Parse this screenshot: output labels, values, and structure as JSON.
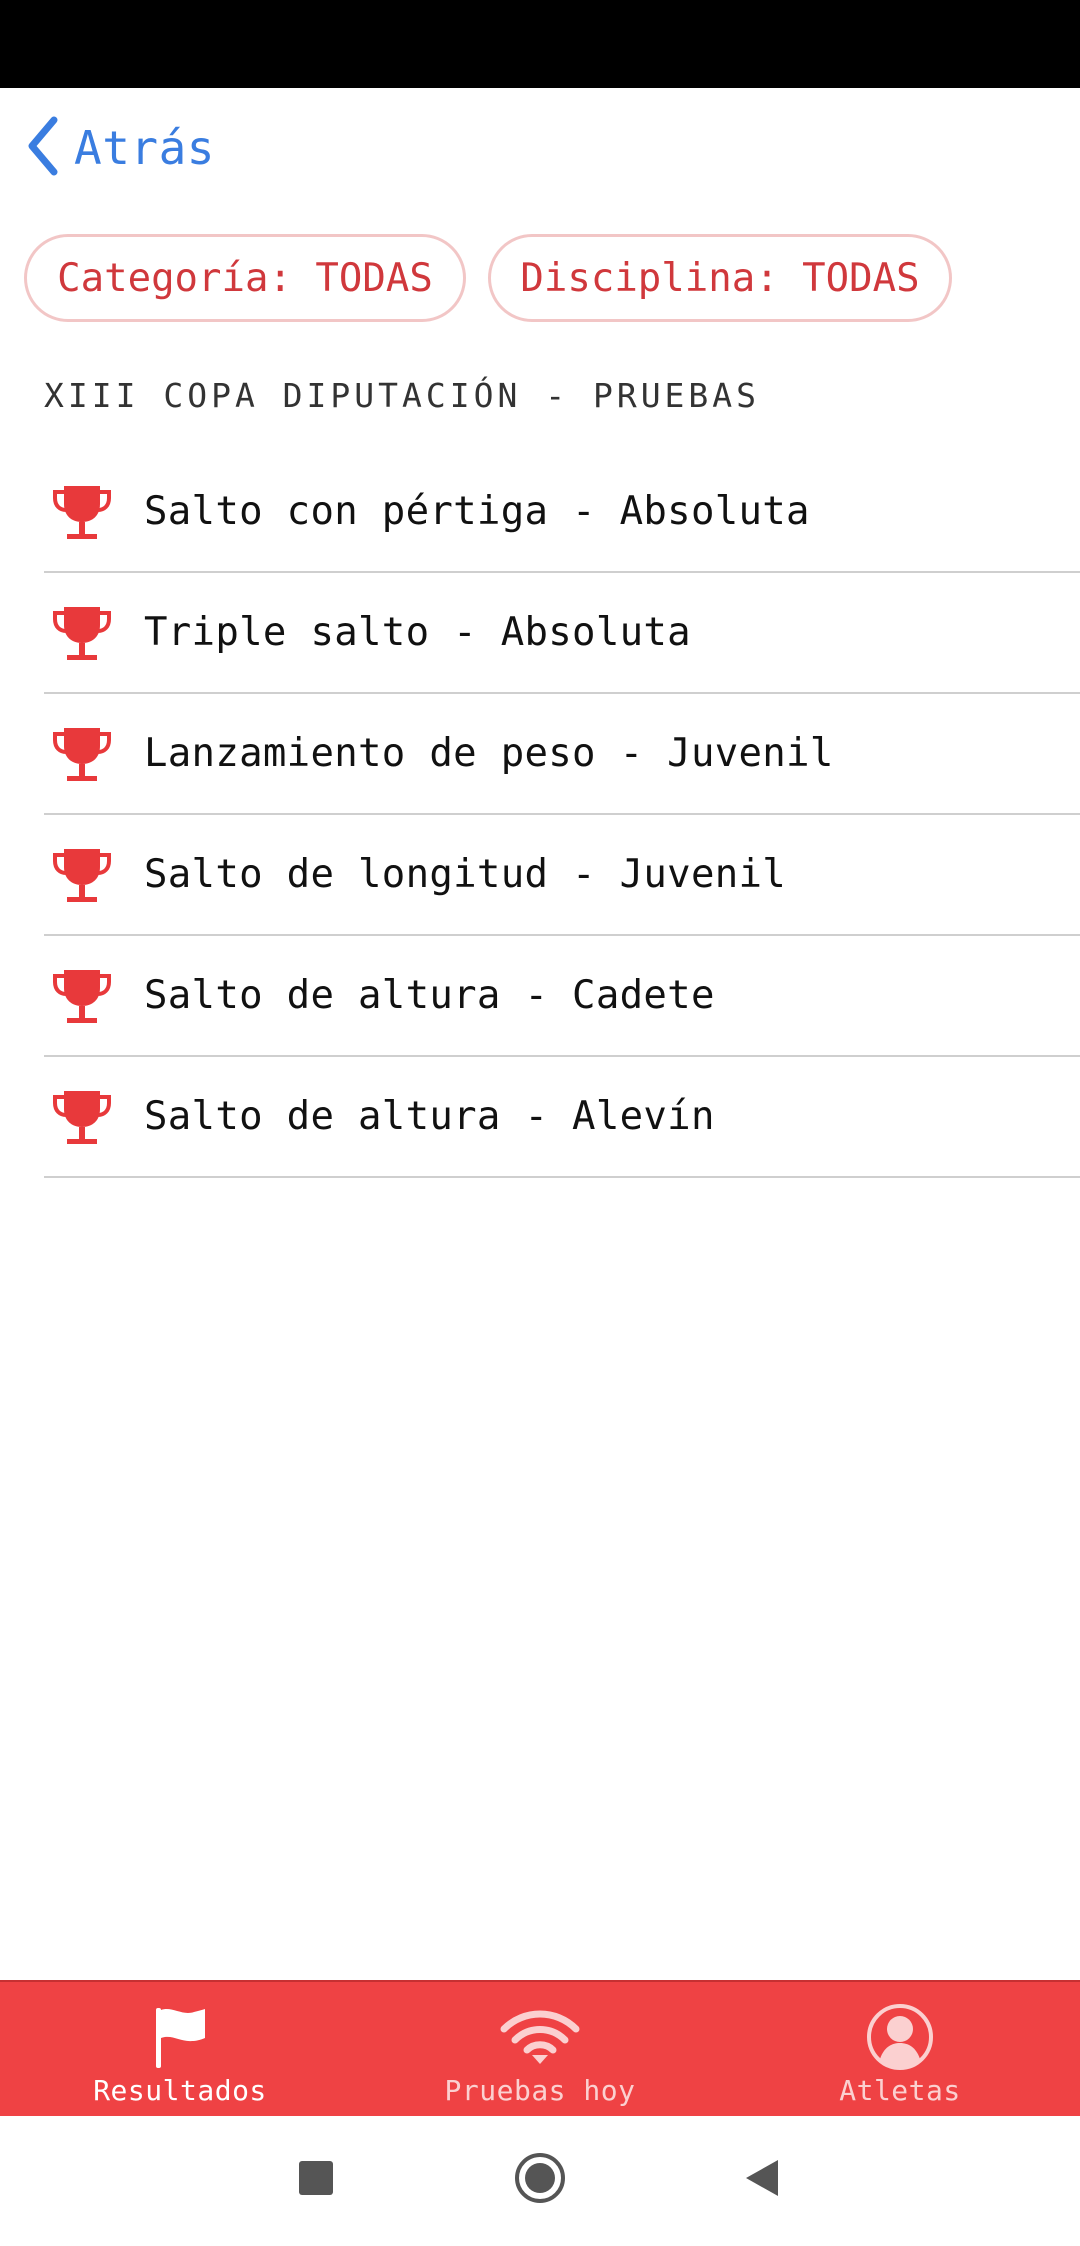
{
  "header": {
    "back_label": "Atrás"
  },
  "filters": {
    "category_label": "Categoría: TODAS",
    "discipline_label": "Disciplina: TODAS"
  },
  "section": {
    "title": "XIII COPA DIPUTACIÓN - PRUEBAS"
  },
  "events": [
    {
      "label": "Salto con pértiga - Absoluta",
      "icon": "trophy-icon"
    },
    {
      "label": "Triple salto - Absoluta",
      "icon": "trophy-icon"
    },
    {
      "label": "Lanzamiento de peso - Juvenil",
      "icon": "trophy-icon"
    },
    {
      "label": "Salto de longitud - Juvenil",
      "icon": "trophy-icon"
    },
    {
      "label": "Salto de altura - Cadete",
      "icon": "trophy-icon"
    },
    {
      "label": "Salto de altura - Alevín",
      "icon": "trophy-icon"
    }
  ],
  "tabs": [
    {
      "label": "Resultados",
      "icon": "flag-icon",
      "active": true
    },
    {
      "label": "Pruebas hoy",
      "icon": "wifi-icon",
      "active": false
    },
    {
      "label": "Atletas",
      "icon": "user-icon",
      "active": false
    }
  ],
  "colors": {
    "accent": "#ef4244",
    "link": "#3a7de0",
    "chip_text": "#d0383c",
    "chip_border": "#f2c6c6"
  }
}
